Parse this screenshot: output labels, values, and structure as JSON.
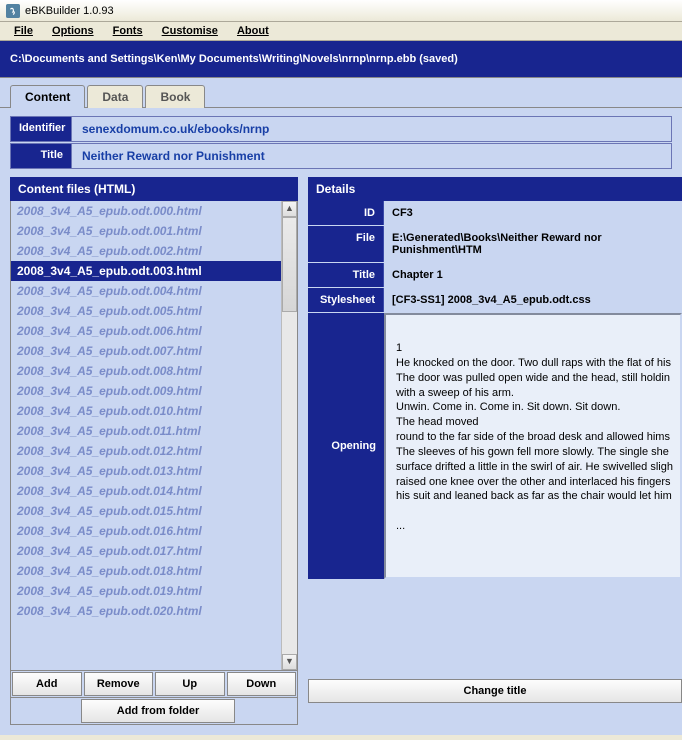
{
  "title": "eBKBuilder 1.0.93",
  "menu": [
    "File",
    "Options",
    "Fonts",
    "Customise",
    "About"
  ],
  "path": "C:\\Documents and Settings\\Ken\\My Documents\\Writing\\Novels\\nrnp\\nrnp.ebb (saved)",
  "tabs": [
    {
      "label": "Content",
      "active": true
    },
    {
      "label": "Data",
      "active": false
    },
    {
      "label": "Book",
      "active": false
    }
  ],
  "identifier_label": "Identifier",
  "identifier_value": "senexdomum.co.uk/ebooks/nrnp",
  "title_label": "Title",
  "title_value": "Neither Reward nor Punishment",
  "left_header": "Content files (HTML)",
  "files": [
    "2008_3v4_A5_epub.odt.000.html",
    "2008_3v4_A5_epub.odt.001.html",
    "2008_3v4_A5_epub.odt.002.html",
    "2008_3v4_A5_epub.odt.003.html",
    "2008_3v4_A5_epub.odt.004.html",
    "2008_3v4_A5_epub.odt.005.html",
    "2008_3v4_A5_epub.odt.006.html",
    "2008_3v4_A5_epub.odt.007.html",
    "2008_3v4_A5_epub.odt.008.html",
    "2008_3v4_A5_epub.odt.009.html",
    "2008_3v4_A5_epub.odt.010.html",
    "2008_3v4_A5_epub.odt.011.html",
    "2008_3v4_A5_epub.odt.012.html",
    "2008_3v4_A5_epub.odt.013.html",
    "2008_3v4_A5_epub.odt.014.html",
    "2008_3v4_A5_epub.odt.015.html",
    "2008_3v4_A5_epub.odt.016.html",
    "2008_3v4_A5_epub.odt.017.html",
    "2008_3v4_A5_epub.odt.018.html",
    "2008_3v4_A5_epub.odt.019.html",
    "2008_3v4_A5_epub.odt.020.html"
  ],
  "selected_index": 3,
  "buttons": {
    "add": "Add",
    "remove": "Remove",
    "up": "Up",
    "down": "Down",
    "addfolder": "Add from folder",
    "changetitle": "Change title"
  },
  "right_header": "Details",
  "details": {
    "id_label": "ID",
    "id": "CF3",
    "file_label": "File",
    "file": "E:\\Generated\\Books\\Neither Reward nor Punishment\\HTM",
    "title_label": "Title",
    "title": "Chapter 1",
    "ss_label": "Stylesheet",
    "ss": "[CF3-SS1] 2008_3v4_A5_epub.odt.css",
    "opening_label": "Opening",
    "opening": " 1\nHe knocked on the door. Two dull raps with the flat of his\nThe door was pulled open wide and the head, still holdin\nwith a sweep of his arm.\nUnwin. Come in. Come in. Sit down. Sit down.\nThe head moved\nround to the far side of the broad desk and allowed hims\nThe sleeves of his gown fell more slowly. The single she\nsurface drifted a little in the swirl of air. He swivelled sligh\nraised one knee over the other and interlaced his  fingers\nhis suit and leaned back as far as the chair would let him\n\n..."
  }
}
